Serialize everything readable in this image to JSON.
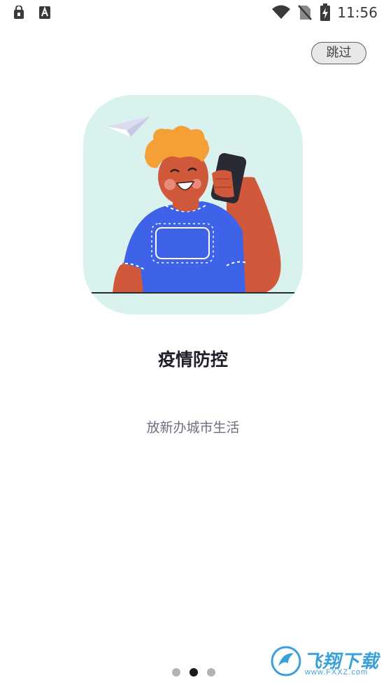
{
  "status_bar": {
    "time": "11:56",
    "left_icons": [
      "lock-bag-icon",
      "font-a-icon"
    ],
    "right_icons": [
      "wifi-icon",
      "no-sim-icon",
      "battery-charging-icon"
    ]
  },
  "skip_button": {
    "label": "跳过"
  },
  "slide": {
    "title": "疫情防控",
    "subtitle": "放新办城市生活"
  },
  "pager": {
    "count": 3,
    "active_index": 1
  },
  "watermark": {
    "brand": "飞翔下载",
    "url": "www.FXXZ.com"
  },
  "colors": {
    "illustration_bg": "#d9f2ee",
    "shirt": "#3f63e8",
    "skin": "#d0593c",
    "hair": "#f5a037",
    "text_title": "#1f1f2b",
    "text_subtitle": "#6e6e80"
  }
}
